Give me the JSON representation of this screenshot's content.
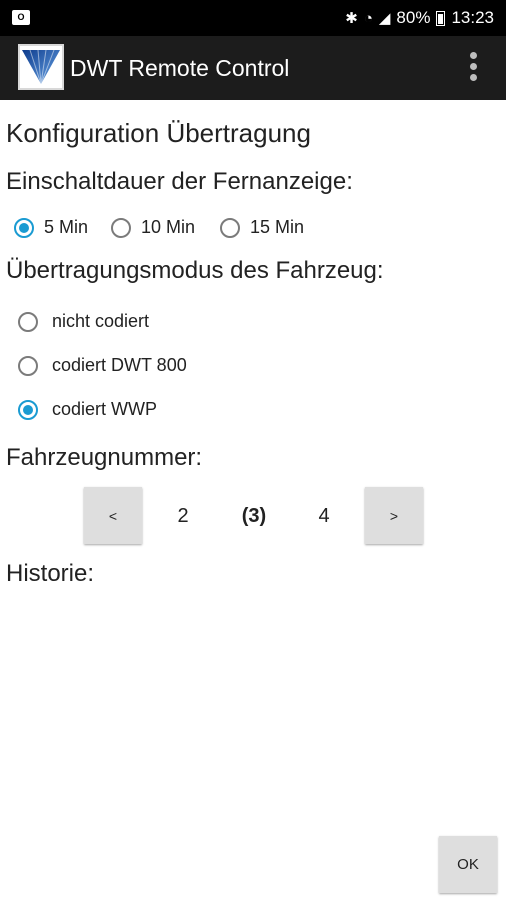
{
  "status_bar": {
    "notification_icon": "outlook-icon",
    "bluetooth_icon": "bluetooth-icon",
    "wifi_icon": "wifi-icon",
    "signal_icon": "signal-icon",
    "battery": "80%",
    "battery_icon": "battery-icon",
    "time": "13:23"
  },
  "app_bar": {
    "title": "DWT Remote Control",
    "menu_icon": "overflow-menu-icon"
  },
  "main": {
    "title": "Konfiguration Übertragung",
    "display_duration": {
      "label": "Einschaltdauer der Fernanzeige:",
      "options": [
        {
          "label": "5 Min",
          "selected": true
        },
        {
          "label": "10 Min",
          "selected": false
        },
        {
          "label": "15 Min",
          "selected": false
        }
      ]
    },
    "transmission_mode": {
      "label": "Übertragungsmodus des Fahrzeug:",
      "options": [
        {
          "label": "nicht codiert",
          "selected": false
        },
        {
          "label": "codiert DWT 800",
          "selected": false
        },
        {
          "label": "codiert WWP",
          "selected": true
        }
      ]
    },
    "vehicle_number": {
      "label": "Fahrzeugnummer:",
      "prev_label": "<",
      "next_label": ">",
      "prev_value": "2",
      "current_value": "(3)",
      "next_value": "4"
    },
    "history_label": "Historie:",
    "ok_label": "OK"
  },
  "colors": {
    "accent": "#1a9bd2",
    "app_bar": "#1c1c1c",
    "status_bar": "#000000",
    "button": "#dedede"
  }
}
